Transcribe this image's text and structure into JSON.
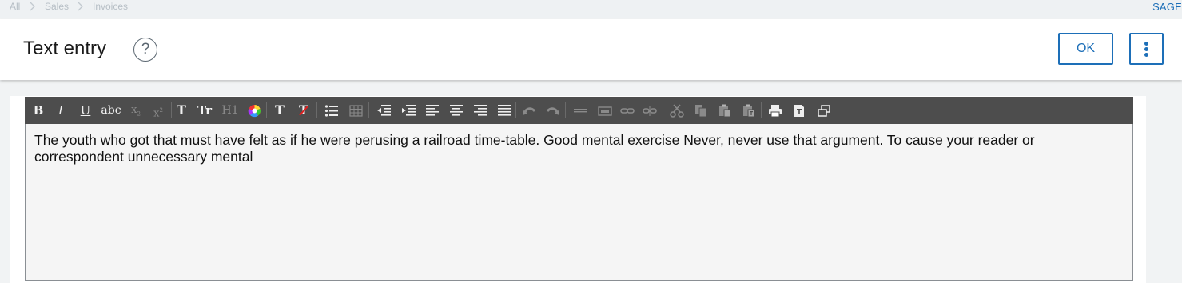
{
  "breadcrumb": {
    "items": [
      "All",
      "Sales",
      "Invoices"
    ]
  },
  "brand": "SAGE",
  "header": {
    "title": "Text entry",
    "help_symbol": "?",
    "ok_label": "OK"
  },
  "toolbar": {
    "bold": "B",
    "italic": "I",
    "underline": "U",
    "strike": "abc",
    "subscript": "x",
    "superscript": "x",
    "font": "T",
    "font_size": "Tr",
    "heading": "H1",
    "text_color_t": "T",
    "clear_format": "T"
  },
  "editor": {
    "content": "The youth who got that must have felt as if he were perusing a railroad time-table. Good mental exercise Never, never use that argument. To cause your reader or correspondent unnecessary mental"
  },
  "colors": {
    "accent": "#1d6fb8",
    "toolbar_bg": "#4d4d4d"
  }
}
